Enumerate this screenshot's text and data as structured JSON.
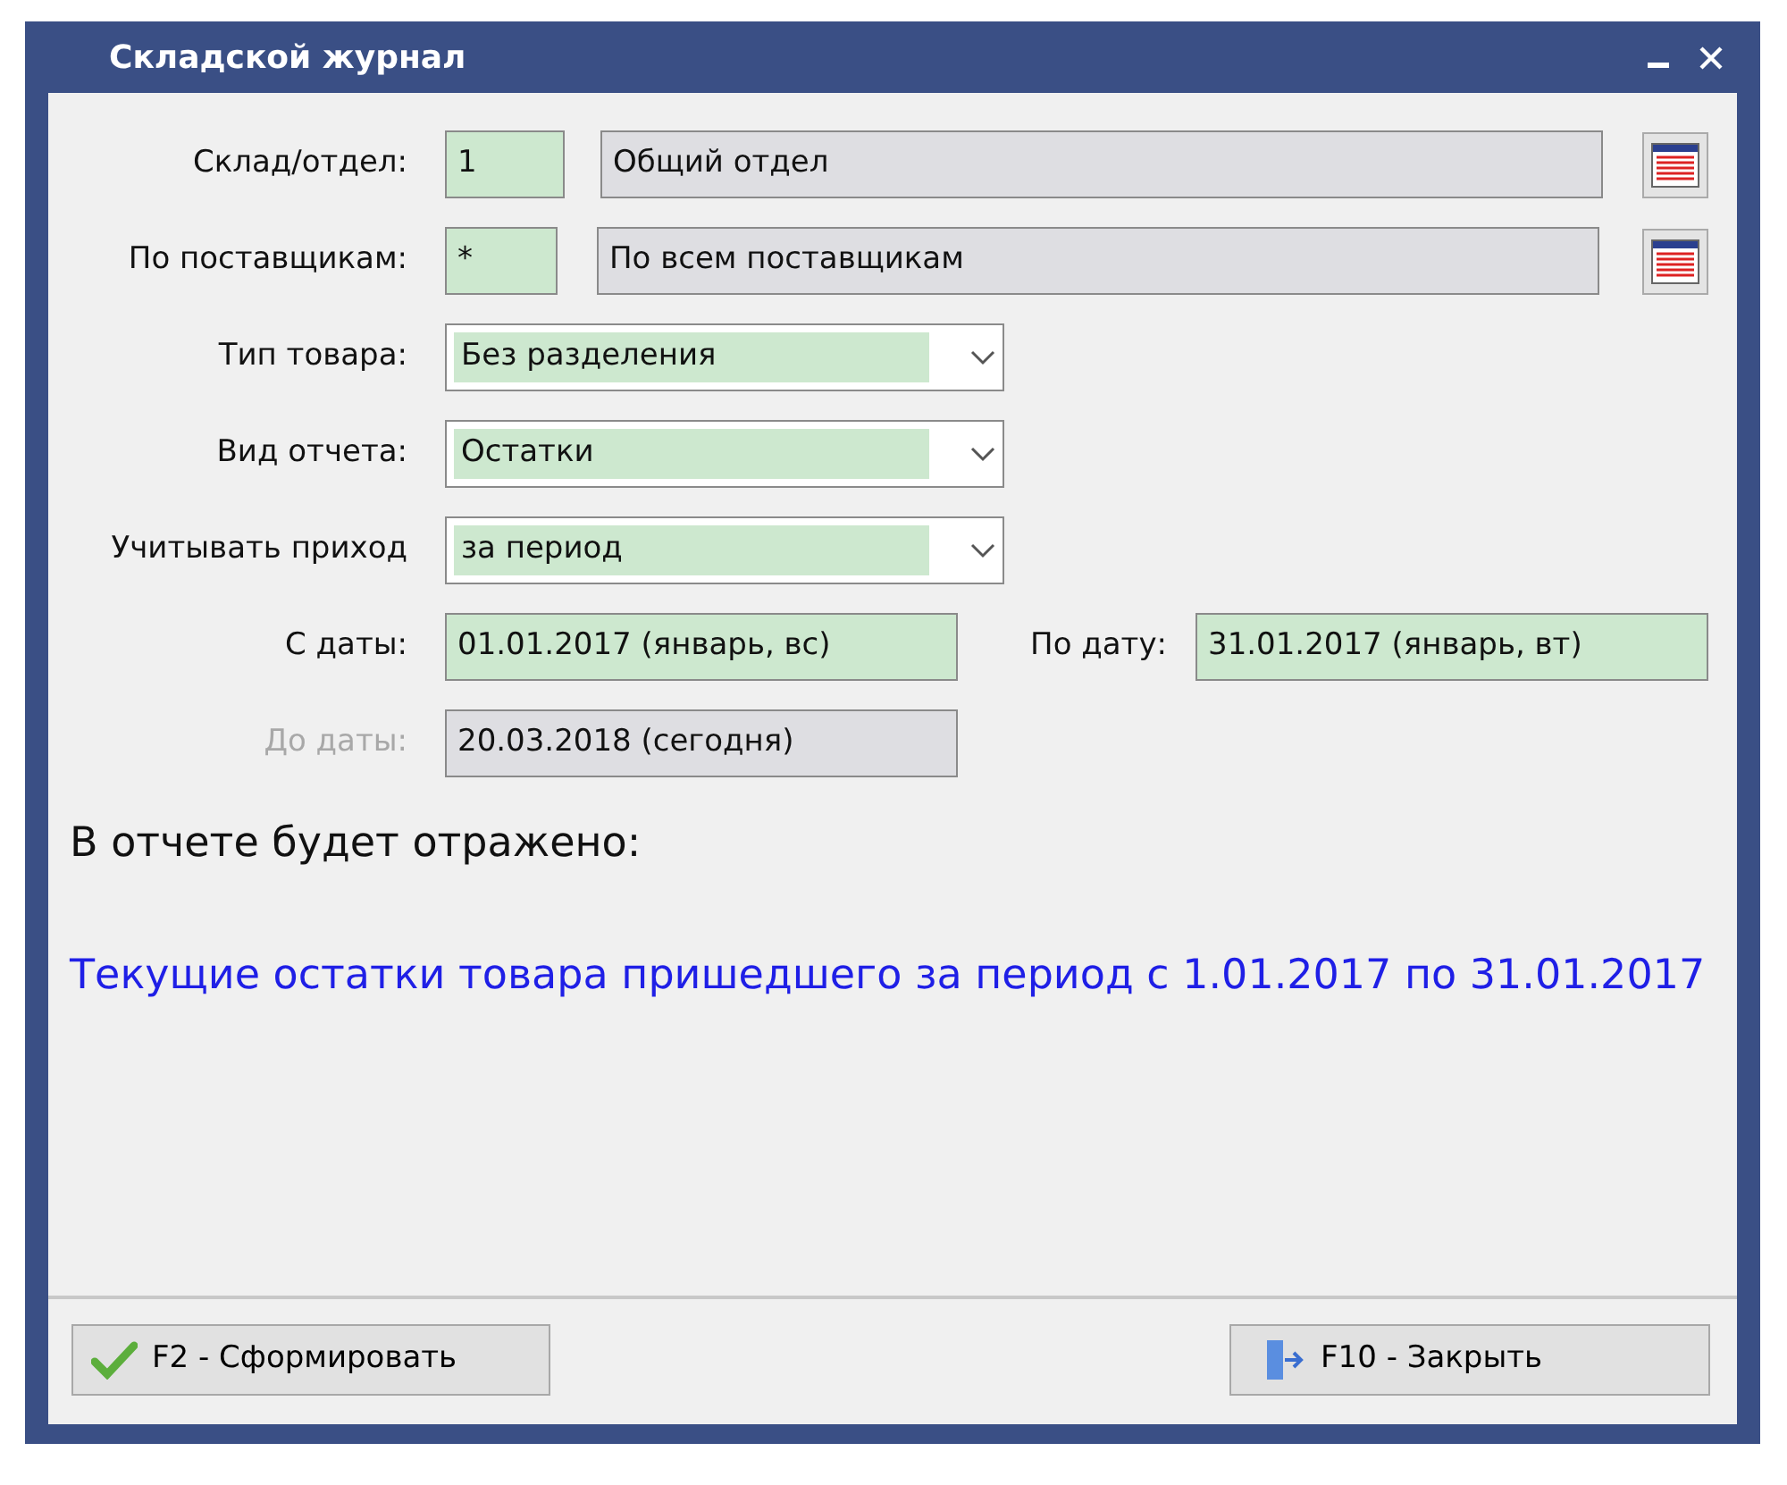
{
  "window": {
    "title": "Складской журнал"
  },
  "fields": [
    {
      "kind": "lookup",
      "label": "Склад/отдел:",
      "code": "1",
      "value": "Общий отдел"
    },
    {
      "kind": "lookup",
      "label": "По поставщикам:",
      "code": "*",
      "value": "По всем поставщикам"
    },
    {
      "kind": "select",
      "label": "Тип товара:",
      "value": "Без разделения"
    },
    {
      "kind": "select",
      "label": "Вид отчета:",
      "value": "Остатки"
    },
    {
      "kind": "select",
      "label": "Учитывать приход",
      "value": "за период"
    },
    {
      "kind": "daterange",
      "label": "С даты:",
      "value": "01.01.2017  (январь, вс)",
      "label_to": "По дату:",
      "value_to": "31.01.2017  (январь, вт)"
    },
    {
      "kind": "date",
      "label": "До даты:",
      "value": "20.03.2018  (сегодня)",
      "disabled": true
    }
  ],
  "summary": {
    "heading": "В отчете будет отражено:",
    "text": "Текущие остатки товара пришедшего за период с 1.01.2017 по 31.01.2017"
  },
  "buttons": [
    {
      "kind": "ok",
      "label": "F2 - Сформировать"
    },
    {
      "kind": "close",
      "label": "F10 - Закрыть"
    }
  ]
}
